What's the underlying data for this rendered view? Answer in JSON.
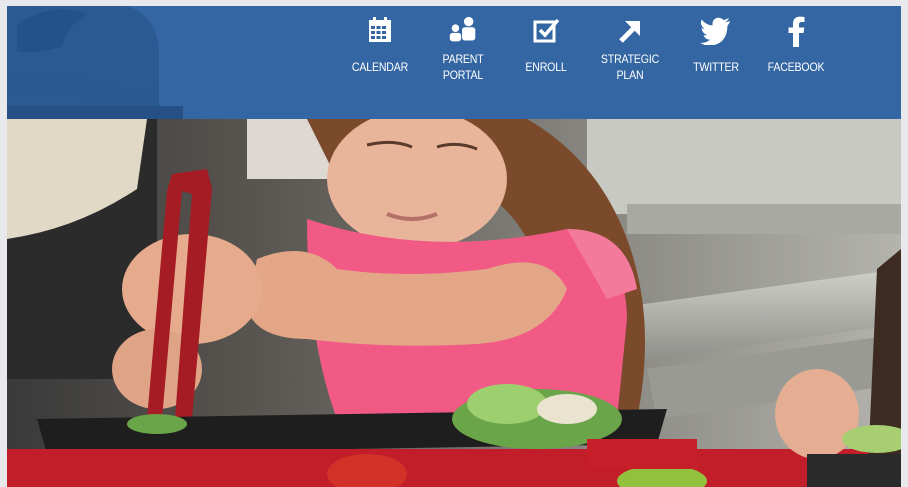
{
  "nav": {
    "items": [
      {
        "label": "CALENDAR",
        "icon": "calendar-icon"
      },
      {
        "label": "PARENT\nPORTAL",
        "icon": "parent-portal-icon"
      },
      {
        "label": "ENROLL",
        "icon": "enroll-checkbox-icon"
      },
      {
        "label": "STRATEGIC\nPLAN",
        "icon": "arrow-up-right-icon"
      },
      {
        "label": "TWITTER",
        "icon": "twitter-icon"
      },
      {
        "label": "FACEBOOK",
        "icon": "facebook-icon"
      }
    ]
  },
  "colors": {
    "header_bg": "#3466a3",
    "nav_text": "#ffffff",
    "page_bg": "#e7e9ec"
  }
}
